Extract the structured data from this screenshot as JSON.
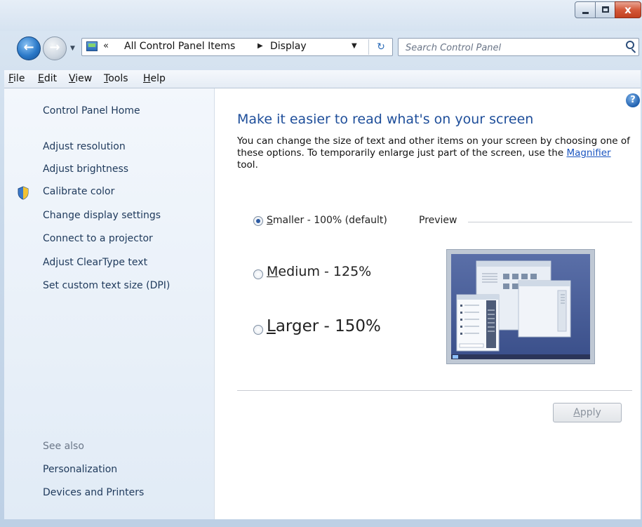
{
  "window": {
    "caption_buttons": {
      "minimize_icon": "minimize-icon",
      "maximize_icon": "maximize-icon",
      "close_glyph": "x"
    }
  },
  "navbar": {
    "address_prefix": "«",
    "crumbs": [
      "All Control Panel Items",
      "Display"
    ],
    "search_placeholder": "Search Control Panel"
  },
  "menubar": {
    "items": [
      {
        "label": "File",
        "key": "F",
        "rest": "ile"
      },
      {
        "label": "Edit",
        "key": "E",
        "rest": "dit"
      },
      {
        "label": "View",
        "key": "V",
        "rest": "iew"
      },
      {
        "label": "Tools",
        "key": "T",
        "rest": "ools"
      },
      {
        "label": "Help",
        "key": "H",
        "rest": "elp"
      }
    ]
  },
  "sidebar": {
    "home": "Control Panel Home",
    "links": [
      "Adjust resolution",
      "Adjust brightness",
      "Calibrate color",
      "Change display settings",
      "Connect to a projector",
      "Adjust ClearType text",
      "Set custom text size (DPI)"
    ],
    "see_also": "See also",
    "see_also_links": [
      "Personalization",
      "Devices and Printers"
    ]
  },
  "main": {
    "heading": "Make it easier to read what's on your screen",
    "desc_before": "You can change the size of text and other items on your screen by choosing one of these options. To temporarily enlarge just part of the screen, use the ",
    "desc_link": "Magnifier",
    "desc_after": " tool.",
    "options": [
      {
        "key": "S",
        "rest": "maller - 100% (default)",
        "selected": true
      },
      {
        "key": "M",
        "rest": "edium - 125%",
        "selected": false
      },
      {
        "key": "L",
        "rest": "arger - 150%",
        "selected": false
      }
    ],
    "preview_label": "Preview",
    "apply_key": "A",
    "apply_rest": "pply"
  },
  "colors": {
    "accent": "#1e4e9a",
    "link": "#1a55c0",
    "sidebar_link": "#1e395b"
  }
}
